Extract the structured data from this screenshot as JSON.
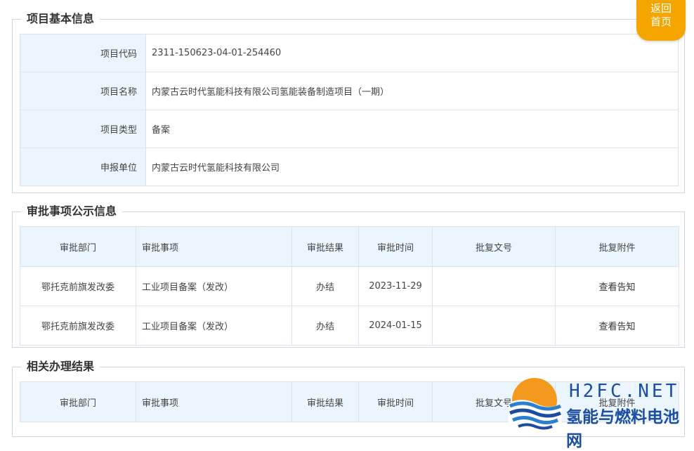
{
  "back_button": {
    "line1": "返回",
    "line2": "首页"
  },
  "basic_info": {
    "title": "项目基本信息",
    "rows": [
      {
        "label": "项目代码",
        "value": "2311-150623-04-01-254460"
      },
      {
        "label": "项目名称",
        "value": "内蒙古云时代氢能科技有限公司氢能装备制造项目（一期）"
      },
      {
        "label": "项目类型",
        "value": "备案"
      },
      {
        "label": "申报单位",
        "value": "内蒙古云时代氢能科技有限公司"
      }
    ]
  },
  "approval": {
    "title": "审批事项公示信息",
    "headers": [
      "审批部门",
      "审批事项",
      "审批结果",
      "审批时间",
      "批复文号",
      "批复附件"
    ],
    "rows": [
      {
        "dept": "鄂托克前旗发改委",
        "item": "工业项目备案（发改）",
        "result": "办结",
        "time": "2023-11-29",
        "doc_no": "",
        "attachment": "查看告知"
      },
      {
        "dept": "鄂托克前旗发改委",
        "item": "工业项目备案（发改）",
        "result": "办结",
        "time": "2024-01-15",
        "doc_no": "",
        "attachment": "查看告知"
      }
    ]
  },
  "related": {
    "title": "相关办理结果",
    "headers": [
      "审批部门",
      "审批事项",
      "审批结果",
      "审批时间",
      "批复文号",
      "批复附件"
    ]
  },
  "watermark": {
    "line1": "H2FC.NET",
    "line2": "氢能与燃料电池网"
  },
  "colors": {
    "header_bg": "#eaf5fd",
    "accent": "#f5a500",
    "watermark_blue": "#1b4da0",
    "watermark_orange": "#f39a1e"
  }
}
